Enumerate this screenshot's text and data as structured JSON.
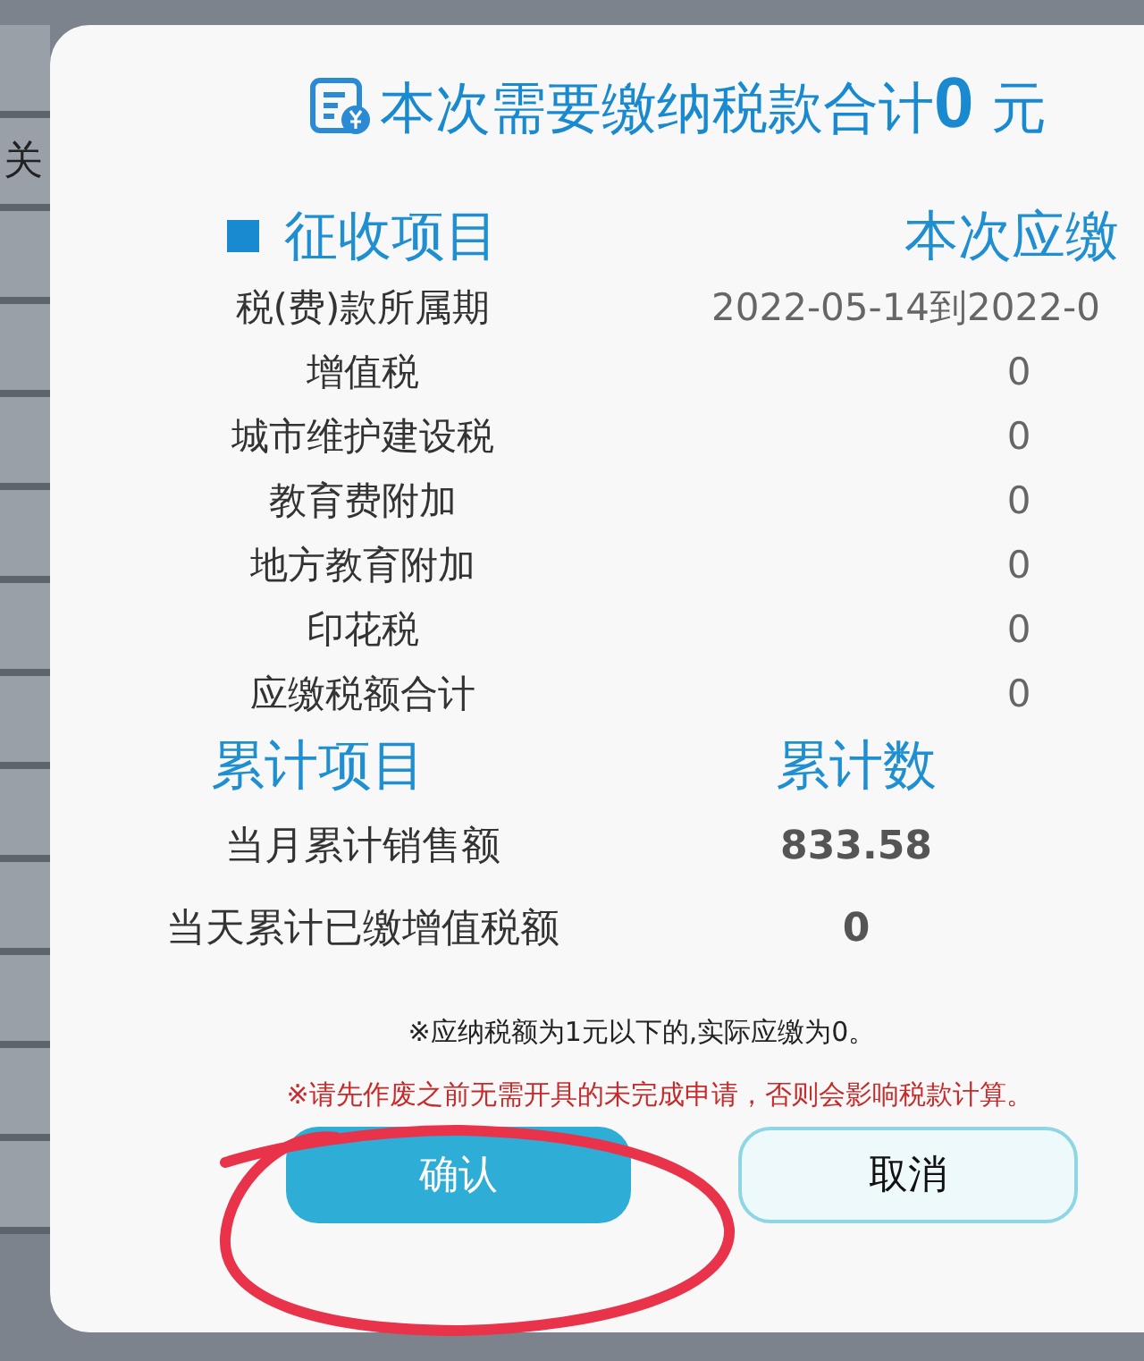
{
  "background": {
    "texts": [
      "关"
    ]
  },
  "dialog": {
    "title": "本次需要缴纳税款合计**0** 元",
    "levy": {
      "heading": "征收项目",
      "value_heading": "本次应缴",
      "rows": [
        {
          "label": "税(费)款所属期",
          "value": "2022-05-14到2022-0",
          "kind": "period"
        },
        {
          "label": "增值税",
          "value": "0",
          "kind": "amount"
        },
        {
          "label": "城市维护建设税",
          "value": "0",
          "kind": "amount"
        },
        {
          "label": "教育费附加",
          "value": "0",
          "kind": "amount"
        },
        {
          "label": "地方教育附加",
          "value": "0",
          "kind": "amount"
        },
        {
          "label": "印花税",
          "value": "0",
          "kind": "amount"
        },
        {
          "label": "应缴税额合计",
          "value": "0",
          "kind": "amount"
        }
      ]
    },
    "cumulative": {
      "heading": "累计项目",
      "value_heading": "累计数",
      "rows": [
        {
          "label": "当月累计销售额",
          "value": "833.58"
        },
        {
          "label": "当天累计已缴增值税额",
          "value": "0"
        }
      ]
    },
    "notes": [
      {
        "text": "※应纳税额为1元以下的,实际应缴为0。",
        "kind": "info"
      },
      {
        "text": "※请先作废之前无需开具的未完成申请，否则会影响税款计算。",
        "kind": "warning"
      }
    ],
    "buttons": [
      {
        "label": "确认",
        "kind": "primary"
      },
      {
        "label": "取消",
        "kind": "secondary"
      }
    ]
  }
}
